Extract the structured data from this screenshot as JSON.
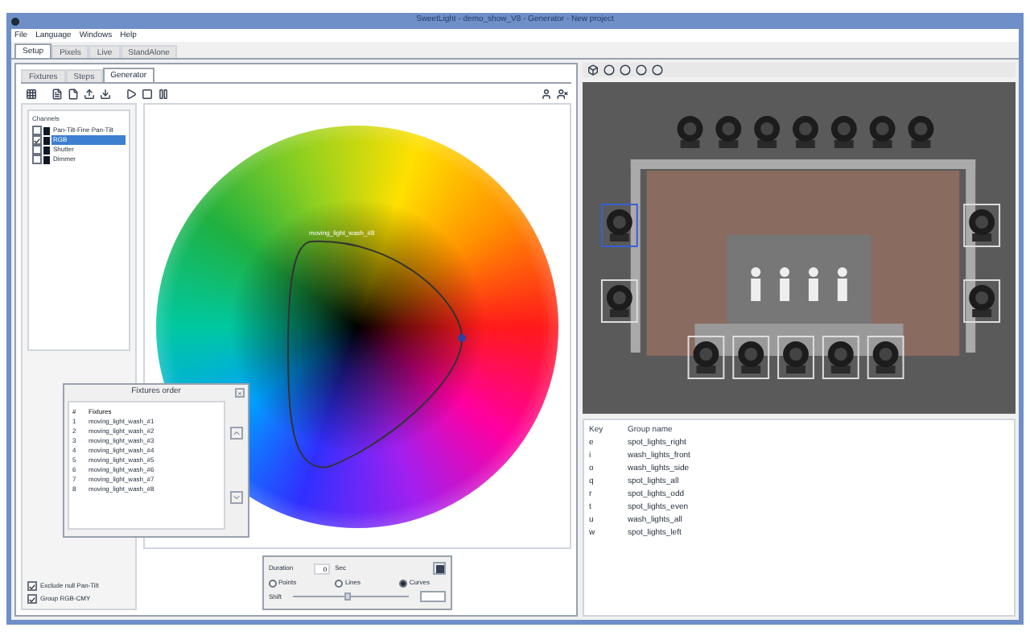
{
  "window": {
    "title": "SweetLight - demo_show_V8 - Generator - New project"
  },
  "menu": [
    "File",
    "Language",
    "Windows",
    "Help"
  ],
  "main_tabs": [
    {
      "label": "Setup",
      "selected": true
    },
    {
      "label": "Pixels",
      "selected": false
    },
    {
      "label": "Live",
      "selected": false
    },
    {
      "label": "StandAlone",
      "selected": false
    }
  ],
  "sub_tabs": [
    {
      "label": "Fixtures",
      "selected": false
    },
    {
      "label": "Steps",
      "selected": false
    },
    {
      "label": "Generator",
      "selected": true
    }
  ],
  "channels": {
    "title": "Channels",
    "items": [
      {
        "label": "Pan-Tilt-Fine Pan-Tilt",
        "checked": false,
        "selected": false
      },
      {
        "label": "RGB",
        "checked": true,
        "selected": true
      },
      {
        "label": "Shutter",
        "checked": false,
        "selected": false
      },
      {
        "label": "Dimmer",
        "checked": false,
        "selected": false
      }
    ]
  },
  "options": [
    {
      "label": "Exclude null Pan-Tilt",
      "checked": true
    },
    {
      "label": "Group RGB-CMY",
      "checked": true
    }
  ],
  "curve": {
    "label": "moving_light_wash_#8"
  },
  "fixtures_order": {
    "title": "Fixtures order",
    "columns": [
      "#",
      "Fixtures"
    ],
    "rows": [
      {
        "index": "1",
        "name": "moving_light_wash_#1"
      },
      {
        "index": "2",
        "name": "moving_light_wash_#2"
      },
      {
        "index": "3",
        "name": "moving_light_wash_#3"
      },
      {
        "index": "4",
        "name": "moving_light_wash_#4"
      },
      {
        "index": "5",
        "name": "moving_light_wash_#5"
      },
      {
        "index": "6",
        "name": "moving_light_wash_#6"
      },
      {
        "index": "7",
        "name": "moving_light_wash_#7"
      },
      {
        "index": "8",
        "name": "moving_light_wash_#8"
      }
    ]
  },
  "generator": {
    "duration_label": "Duration",
    "duration": "0",
    "unit": "Sec",
    "shift_label": "Shift",
    "level": 0.45,
    "modes": [
      {
        "label": "Points",
        "selected": false
      },
      {
        "label": "Lines",
        "selected": false
      },
      {
        "label": "Curves",
        "selected": true
      }
    ]
  },
  "groups": {
    "columns": [
      "Key",
      "Group name"
    ],
    "rows": [
      {
        "key": "e",
        "name": "spot_lights_right"
      },
      {
        "key": "i",
        "name": "wash_lights_front"
      },
      {
        "key": "o",
        "name": "wash_lights_side"
      },
      {
        "key": "q",
        "name": "spot_lights_all"
      },
      {
        "key": "r",
        "name": "spot_lights_odd"
      },
      {
        "key": "t",
        "name": "spot_lights_even"
      },
      {
        "key": "u",
        "name": "wash_lights_all"
      },
      {
        "key": "w",
        "name": "spot_lights_left"
      }
    ]
  }
}
